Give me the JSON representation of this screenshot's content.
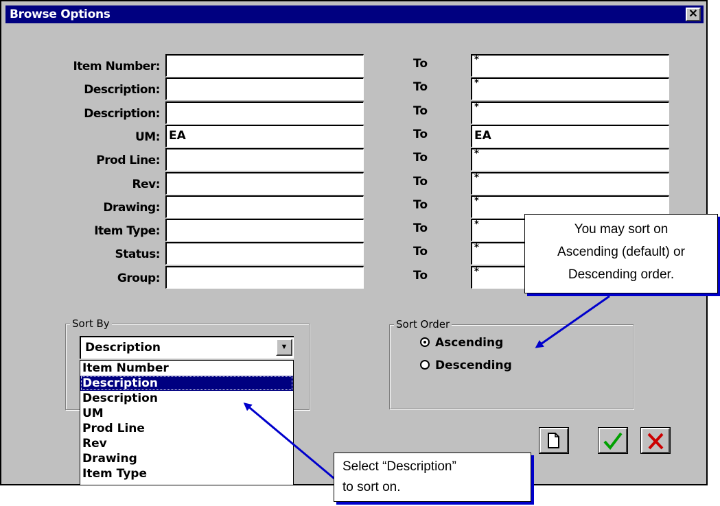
{
  "window": {
    "title": "Browse Options",
    "close_glyph": "✕"
  },
  "fields": [
    {
      "label": "Item Number:",
      "from": "",
      "to_label": "To",
      "to": "*"
    },
    {
      "label": "Description:",
      "from": "",
      "to_label": "To",
      "to": "*"
    },
    {
      "label": "Description:",
      "from": "",
      "to_label": "To",
      "to": "*"
    },
    {
      "label": "UM:",
      "from": "EA",
      "to_label": "To",
      "to": "EA"
    },
    {
      "label": "Prod Line:",
      "from": "",
      "to_label": "To",
      "to": "*"
    },
    {
      "label": "Rev:",
      "from": "",
      "to_label": "To",
      "to": "*"
    },
    {
      "label": "Drawing:",
      "from": "",
      "to_label": "To",
      "to": "*"
    },
    {
      "label": "Item Type:",
      "from": "",
      "to_label": "To",
      "to": "*"
    },
    {
      "label": "Status:",
      "from": "",
      "to_label": "To",
      "to": "*"
    },
    {
      "label": "Group:",
      "from": "",
      "to_label": "To",
      "to": "*"
    }
  ],
  "sort_by": {
    "legend": "Sort By",
    "selected": "Description",
    "options": [
      "Item Number",
      "Description",
      "Description",
      "UM",
      "Prod Line",
      "Rev",
      "Drawing",
      "Item Type"
    ],
    "highlighted_index": 1
  },
  "sort_order": {
    "legend": "Sort Order",
    "options": [
      {
        "label": "Ascending",
        "checked": true
      },
      {
        "label": "Descending",
        "checked": false
      }
    ]
  },
  "buttons": {
    "new_icon": "document-icon",
    "ok_icon": "checkmark-icon",
    "cancel_icon": "x-icon"
  },
  "callouts": {
    "sort_order": [
      "You may sort on",
      "Ascending (default) or",
      "Descending order."
    ],
    "sort_by": [
      "Select “Description”",
      "to sort on."
    ]
  },
  "colors": {
    "title_bar": "#000080",
    "window_bg": "#c0c0c0",
    "arrow": "#0000cc",
    "ok_green": "#00a000",
    "cancel_red": "#cc0000"
  }
}
